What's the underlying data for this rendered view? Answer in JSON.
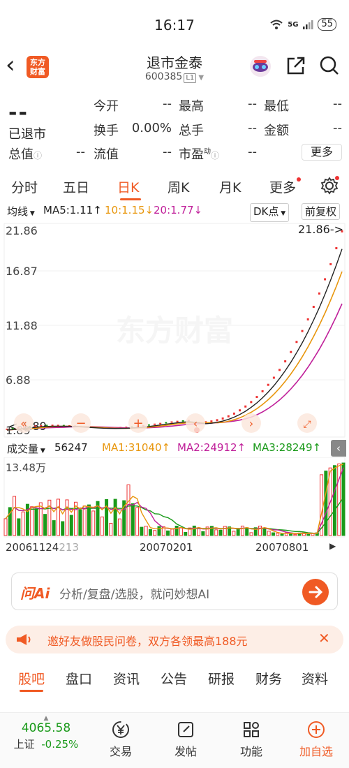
{
  "status_bar": {
    "time": "16:17",
    "network": "5G",
    "battery": "55"
  },
  "header": {
    "logo_text": "东方\n财富",
    "title": "退市金泰",
    "code": "600385",
    "level_tag": "L1"
  },
  "quote": {
    "price": "--",
    "status": "已退市",
    "rows": [
      [
        {
          "label": "今开",
          "value": "--"
        },
        {
          "label": "最高",
          "value": "--"
        },
        {
          "label": "最低",
          "value": "--"
        }
      ],
      [
        {
          "label": "换手",
          "value": "0.00%"
        },
        {
          "label": "总手",
          "value": "--"
        },
        {
          "label": "金额",
          "value": "--"
        }
      ],
      [
        {
          "label": "总值",
          "value": "--"
        },
        {
          "label": "流值",
          "value": "--"
        },
        {
          "label": "市盈",
          "value": "--"
        }
      ]
    ],
    "pe_superscript": "动",
    "more_label": "更多"
  },
  "chart_tabs": {
    "items": [
      "分时",
      "五日",
      "日K",
      "周K",
      "月K",
      "更多"
    ],
    "active": "日K"
  },
  "ma_bar": {
    "type_label": "均线",
    "ma5": "MA5:1.11↑",
    "ma10": "10:1.15↓",
    "ma20": "20:1.77↓",
    "dk_label": "DK点",
    "adjust_label": "前复权",
    "colors": {
      "ma5": "#222222",
      "ma10": "#e8960c",
      "ma20": "#c0209a"
    }
  },
  "price_chart": {
    "y_ticks": [
      "21.86",
      "16.87",
      "11.88",
      "6.88",
      "1.89"
    ],
    "max_marker": "21.86->",
    "min_marker": "<-1.89",
    "watermark": "东方财富"
  },
  "volume_bar": {
    "label": "成交量",
    "value": "56247",
    "ma1": "MA1:31040↑",
    "ma2": "MA2:24912↑",
    "ma3": "MA3:28249↑",
    "y_max": "13.48万",
    "colors": {
      "ma1": "#e8960c",
      "ma2": "#c0209a",
      "ma3": "#1a9a1a"
    }
  },
  "dates": [
    "20061124",
    "20070201",
    "20070801"
  ],
  "ai_bar": {
    "brand": "问Ai",
    "placeholder": "分析/复盘/选股，就问妙想AI"
  },
  "notice": {
    "text": "邀好友做股民问卷，双方各领最高188元"
  },
  "bottom_tabs": {
    "items": [
      "股吧",
      "盘口",
      "资讯",
      "公告",
      "研报",
      "财务",
      "资料"
    ],
    "active": "股吧"
  },
  "bottom_nav": {
    "index_value": "4065.58",
    "index_name": "上证",
    "index_change": "-0.25%",
    "items": [
      "交易",
      "发帖",
      "功能",
      "加自选"
    ]
  },
  "chart_data": {
    "type": "bar",
    "title": "",
    "series": [
      {
        "name": "MA5",
        "values": [
          1.11
        ]
      },
      {
        "name": "10",
        "values": [
          1.15
        ]
      },
      {
        "name": "20",
        "values": [
          1.77
        ]
      }
    ],
    "ylim": [
      1.89,
      21.86
    ],
    "volume_ylim": [
      0,
      134800
    ],
    "volume_last": 56247
  }
}
